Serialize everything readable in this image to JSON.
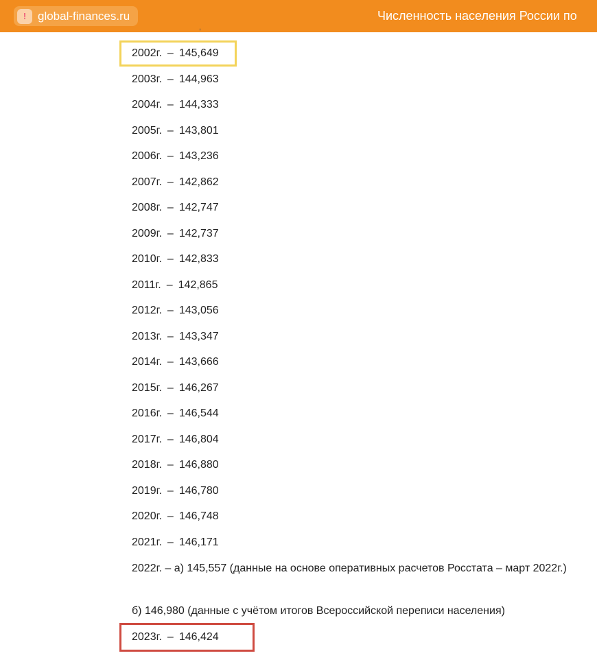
{
  "header": {
    "site_url": "global-finances.ru",
    "page_title": "Численность населения России по",
    "warning_icon": "exclamation-icon",
    "bar_color": "#f28c1e"
  },
  "rows": [
    {
      "year": "2002г.",
      "value": "145,649"
    },
    {
      "year": "2003г.",
      "value": "144,963"
    },
    {
      "year": "2004г.",
      "value": "144,333"
    },
    {
      "year": "2005г.",
      "value": "143,801"
    },
    {
      "year": "2006г.",
      "value": "143,236"
    },
    {
      "year": "2007г.",
      "value": "142,862"
    },
    {
      "year": "2008г.",
      "value": "142,747"
    },
    {
      "year": "2009г.",
      "value": "142,737"
    },
    {
      "year": "2010г.",
      "value": "142,833"
    },
    {
      "year": "2011г.",
      "value": "142,865"
    },
    {
      "year": "2012г.",
      "value": "143,056"
    },
    {
      "year": "2013г.",
      "value": "143,347"
    },
    {
      "year": "2014г.",
      "value": "143,666"
    },
    {
      "year": "2015г.",
      "value": "146,267"
    },
    {
      "year": "2016г.",
      "value": "146,544"
    },
    {
      "year": "2017г.",
      "value": "146,804"
    },
    {
      "year": "2018г.",
      "value": "146,880"
    },
    {
      "year": "2019г.",
      "value": "146,780"
    },
    {
      "year": "2020г.",
      "value": "146,748"
    },
    {
      "year": "2021г.",
      "value": "146,171"
    }
  ],
  "row_dash": "–",
  "note_2022a": "2022г.  – а) 145,557 (данные на основе оперативных расчетов Росстата – март 2022г.)",
  "note_2022b": "б) 146,980 (данные с учётом итогов Всероссийской переписи населения)",
  "row_2023": {
    "year": "2023г.",
    "value": "146,424"
  },
  "highlight_colors": {
    "first": "#f3d35a",
    "last": "#cf4b41"
  }
}
